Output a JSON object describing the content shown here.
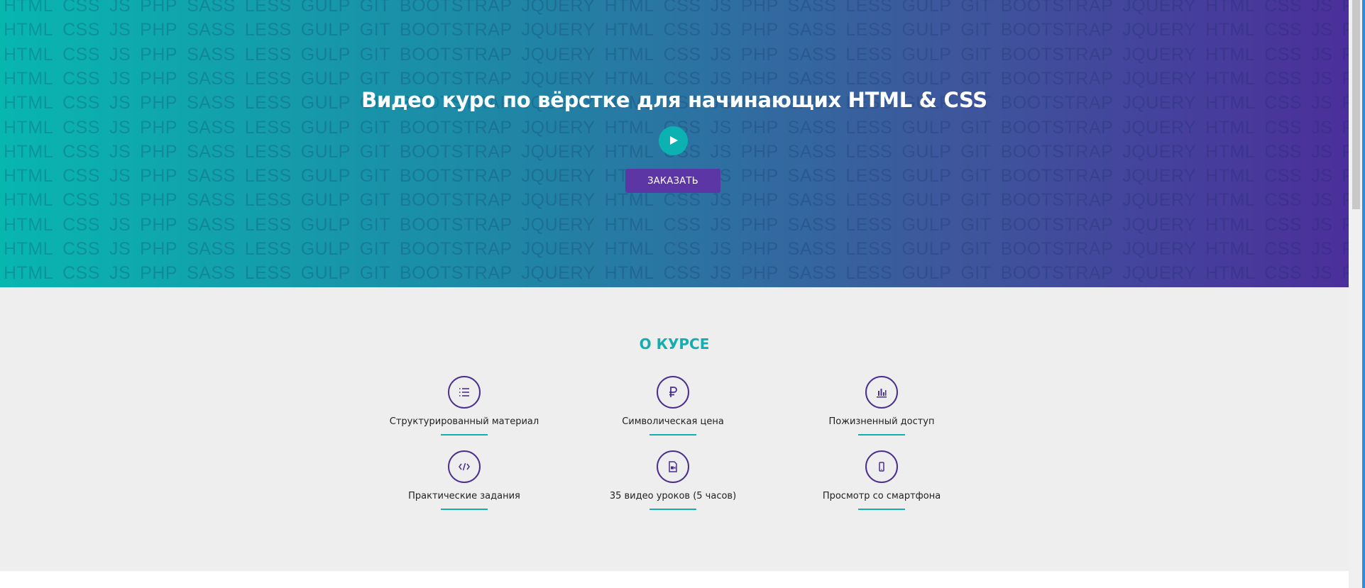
{
  "hero": {
    "background_words": [
      "HTML",
      "CSS",
      "JS",
      "PHP",
      "SASS",
      "LESS",
      "GULP",
      "GIT",
      "BOOTSTRAP",
      "JQUERY"
    ],
    "title": "Видео курс по вёрстке для начинающих HTML & CSS",
    "order_label": "ЗАКАЗАТЬ",
    "colors": {
      "gradient_start": "#08b6b0",
      "gradient_end": "#4b2f9b",
      "play": "#0bb2b1",
      "button": "#5d36a6"
    }
  },
  "about": {
    "title": "О КУРСЕ",
    "features": [
      {
        "icon": "list-icon",
        "label": "Структурированный материал"
      },
      {
        "icon": "ruble-icon",
        "label": "Символическая цена"
      },
      {
        "icon": "bar-chart-icon",
        "label": "Пожизненный доступ"
      },
      {
        "icon": "code-icon",
        "label": "Практические задания"
      },
      {
        "icon": "video-file-icon",
        "label": "35 видео уроков (5 часов)"
      },
      {
        "icon": "smartphone-icon",
        "label": "Просмотр со смартфона"
      }
    ],
    "colors": {
      "accent": "#14aeb1",
      "icon_border": "#4a2f8e"
    }
  }
}
